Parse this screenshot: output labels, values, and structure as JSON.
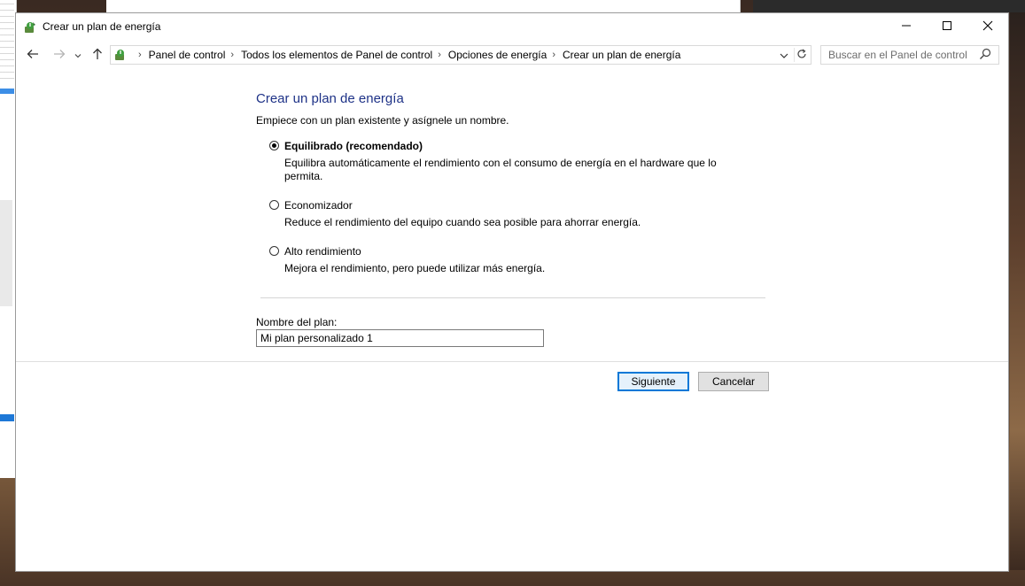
{
  "window": {
    "title": "Crear un plan de energía"
  },
  "address_bar": {
    "breadcrumbs": [
      "Panel de control",
      "Todos los elementos de Panel de control",
      "Opciones de energía",
      "Crear un plan de energía"
    ]
  },
  "search": {
    "placeholder": "Buscar en el Panel de control"
  },
  "page": {
    "title": "Crear un plan de energía",
    "instructions": "Empiece con un plan existente y asígnele un nombre.",
    "plans": [
      {
        "label": "Equilibrado (recomendado)",
        "description": "Equilibra automáticamente el rendimiento con el consumo de energía en el hardware que lo permita.",
        "selected": true
      },
      {
        "label": "Economizador",
        "description": "Reduce el rendimiento del equipo cuando sea posible para ahorrar energía.",
        "selected": false
      },
      {
        "label": "Alto rendimiento",
        "description": "Mejora el rendimiento, pero puede utilizar más energía.",
        "selected": false
      }
    ],
    "plan_name_label": "Nombre del plan:",
    "plan_name_value": "Mi plan personalizado 1"
  },
  "buttons": {
    "next": "Siguiente",
    "cancel": "Cancelar"
  },
  "colors": {
    "title_blue": "#1e3287",
    "accent": "#0078d7"
  },
  "icons": {
    "app": "power-options-icon",
    "back": "arrow-left-icon",
    "forward": "arrow-right-icon",
    "recent": "chevron-down-icon",
    "up": "arrow-up-icon",
    "refresh": "refresh-icon",
    "search": "search-icon",
    "minimize": "minimize-icon",
    "maximize": "maximize-icon",
    "close": "close-icon"
  }
}
